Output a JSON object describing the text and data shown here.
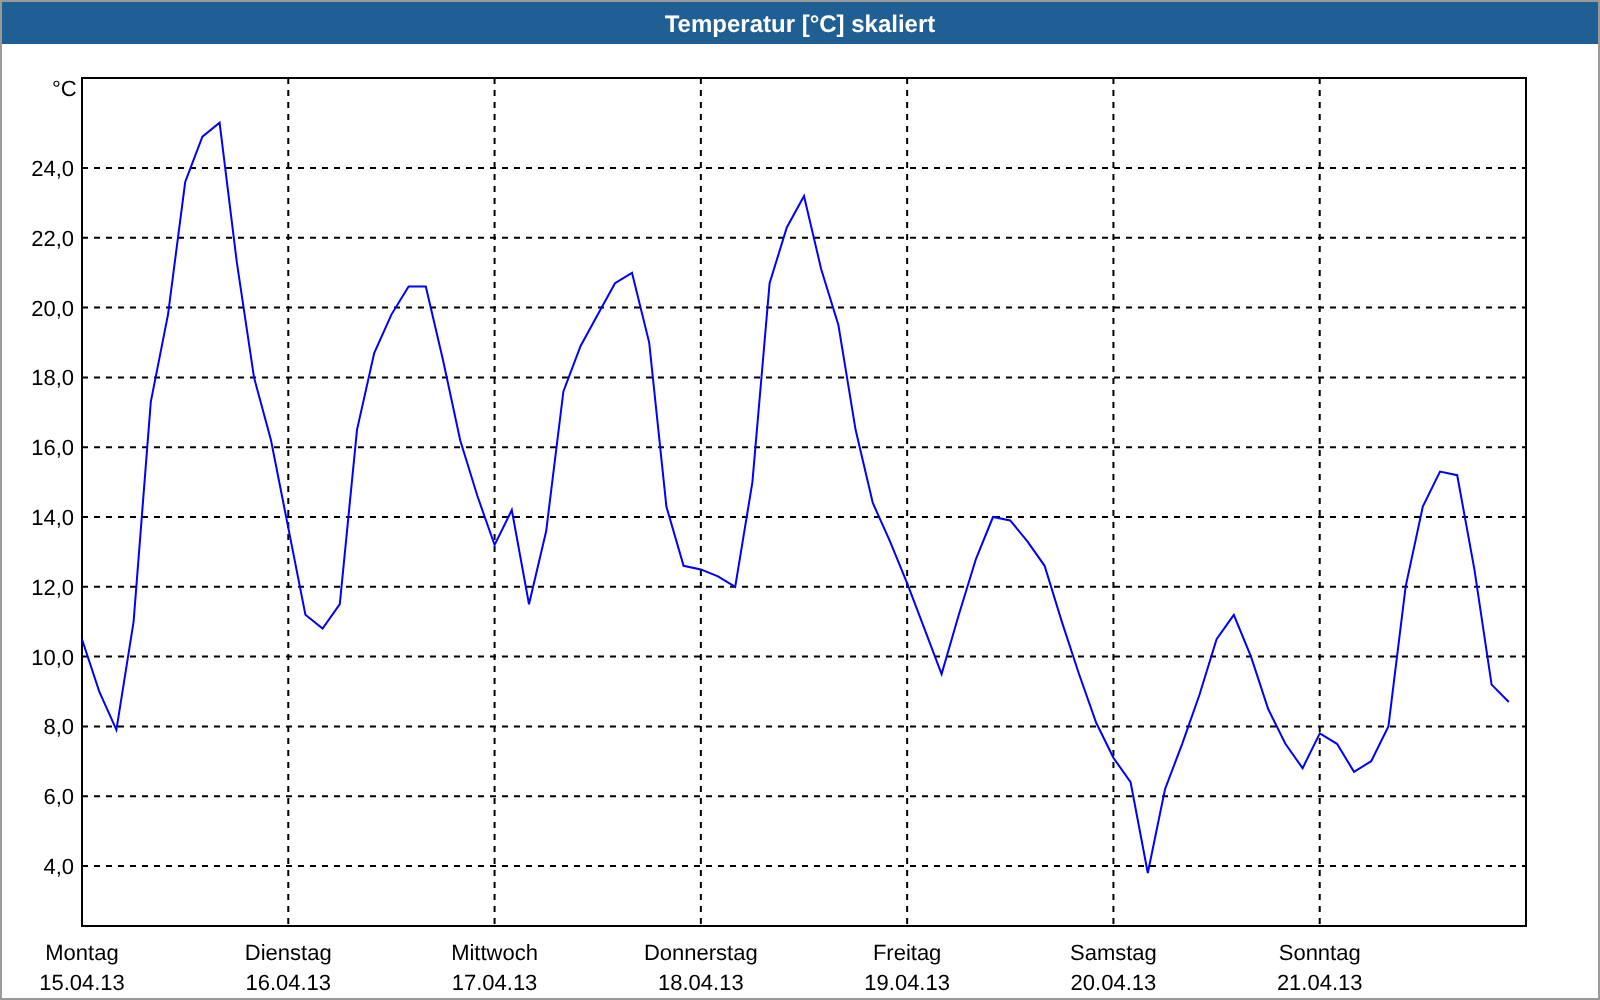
{
  "window": {
    "title": "Temperatur [°C] skaliert"
  },
  "chart": {
    "unit_label": "°C",
    "date_labels": [
      "15.04.13",
      "16.04.13",
      "17.04.13",
      "18.04.13",
      "19.04.13",
      "20.04.13",
      "21.04.13"
    ],
    "chart_data": {
      "type": "line",
      "grid": true,
      "ylim": [
        2.28,
        26.58
      ],
      "categories": [
        "Montag",
        null,
        null,
        null,
        null,
        null,
        null,
        null,
        null,
        null,
        null,
        null,
        "Dienstag",
        null,
        null,
        null,
        null,
        null,
        null,
        null,
        null,
        null,
        null,
        null,
        "Mittwoch",
        null,
        null,
        null,
        null,
        null,
        null,
        null,
        null,
        null,
        null,
        null,
        "Donnerstag",
        null,
        null,
        null,
        null,
        null,
        null,
        null,
        null,
        null,
        null,
        null,
        "Freitag",
        null,
        null,
        null,
        null,
        null,
        null,
        null,
        null,
        null,
        null,
        null,
        "Samstag",
        null,
        null,
        null,
        null,
        null,
        null,
        null,
        null,
        null,
        null,
        null,
        "Sonntag",
        null,
        null,
        null,
        null,
        null,
        null,
        null,
        null,
        null,
        null,
        null
      ],
      "yticks": [
        {
          "value": 4,
          "label": "4,0"
        },
        {
          "value": 6,
          "label": "6,0"
        },
        {
          "value": 8,
          "label": "8,0"
        },
        {
          "value": 10,
          "label": "10,0"
        },
        {
          "value": 12,
          "label": "12,0"
        },
        {
          "value": 14,
          "label": "14,0"
        },
        {
          "value": 16,
          "label": "16,0"
        },
        {
          "value": 18,
          "label": "18,0"
        },
        {
          "value": 20,
          "label": "20,0"
        },
        {
          "value": 22,
          "label": "22,0"
        },
        {
          "value": 24,
          "label": "24,0"
        }
      ],
      "series": [
        {
          "color": "#0000ff",
          "values": [
            10.5,
            9.0,
            7.9,
            11,
            17.3,
            19.8,
            23.6,
            24.9,
            25.3,
            21.3,
            18,
            16.2,
            13.7,
            11.2,
            10.8,
            11.5,
            16.5,
            18.7,
            19.8,
            20.6,
            20.6,
            18.5,
            16.2,
            14.6,
            13.2,
            14.2,
            11.5,
            13.6,
            17.6,
            18.9,
            19.8,
            20.7,
            21,
            19,
            14.3,
            12.6,
            12.5,
            12.3,
            12,
            15,
            20.7,
            22.3,
            23.2,
            21.1,
            19.5,
            16.5,
            14.4,
            13.3,
            12.1,
            10.8,
            9.5,
            11.2,
            12.8,
            14,
            13.9,
            13.3,
            12.6,
            11,
            9.5,
            8.1,
            7.1,
            6.4,
            3.8,
            6.2,
            7.5,
            8.9,
            10.5,
            11.2,
            10,
            8.5,
            7.5,
            6.8,
            7.8,
            7.5,
            6.7,
            7,
            8,
            12,
            14.3,
            15.3,
            15.2,
            12.5,
            9.2,
            8.7
          ]
        }
      ]
    }
  }
}
